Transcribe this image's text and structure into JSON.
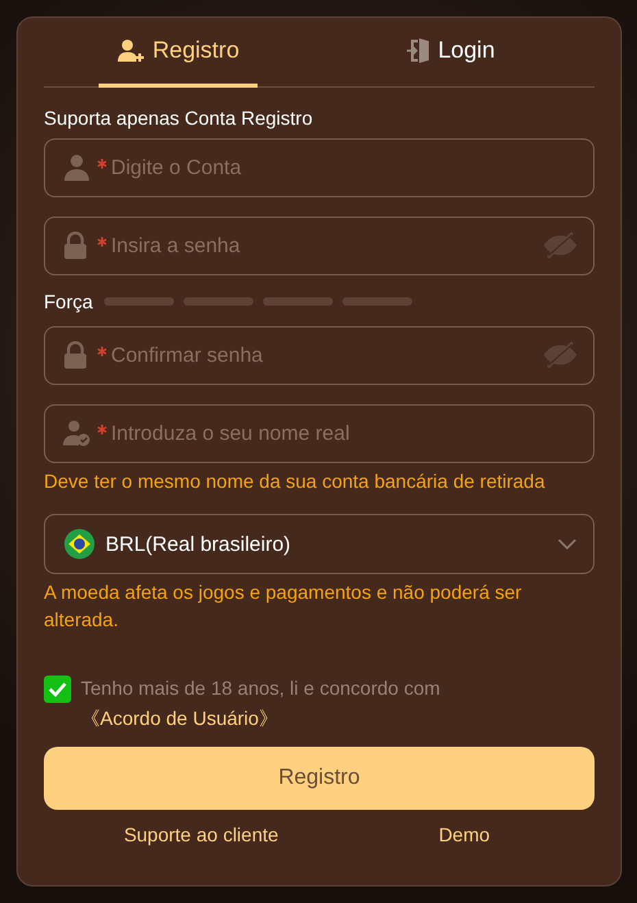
{
  "tabs": [
    {
      "label": "Registro",
      "selected": true
    },
    {
      "label": "Login",
      "selected": false
    }
  ],
  "note": "Suporta apenas Conta Registro",
  "fields": [
    {
      "kind": "account",
      "required": true,
      "placeholder": "Digite o Conta"
    },
    {
      "kind": "password",
      "required": true,
      "placeholder": "Insira a senha"
    },
    {
      "kind": "strength",
      "label": "Força"
    },
    {
      "kind": "password",
      "required": true,
      "placeholder": "Confirmar senha"
    },
    {
      "kind": "realname",
      "required": true,
      "placeholder": "Introduza o seu nome real",
      "hint": "Deve ter o mesmo nome da sua conta bancária de retirada"
    },
    {
      "kind": "currency",
      "value": "BRL(Real brasileiro)",
      "hint": "A moeda afeta os jogos e pagamentos e não poderá ser alterada."
    }
  ],
  "agreement": {
    "checked": true,
    "text": "Tenho mais de 18 anos, li e concordo com",
    "link": "《Acordo de Usuário》"
  },
  "submit": "Registro",
  "footer_links": [
    "Suporte ao cliente",
    "Demo"
  ]
}
